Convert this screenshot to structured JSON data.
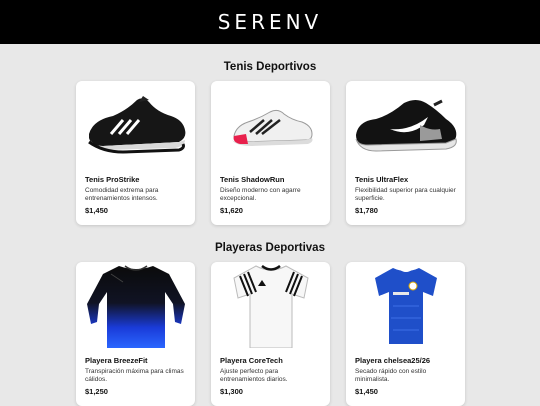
{
  "header": {
    "brand": "SERENV"
  },
  "sections": [
    {
      "title": "Tenis Deportivos",
      "products": [
        {
          "name": "Tenis ProStrike",
          "description": "Comodidad extrema para entrenamientos intensos.",
          "price": "$1,450",
          "image_icon": "black-running-shoe-icon"
        },
        {
          "name": "Tenis ShadowRun",
          "description": "Diseño moderno con agarre excepcional.",
          "price": "$1,620",
          "image_icon": "white-red-running-shoe-icon"
        },
        {
          "name": "Tenis UltraFlex",
          "description": "Flexibilidad superior para cualquier superficie.",
          "price": "$1,780",
          "image_icon": "black-white-training-shoe-icon"
        }
      ]
    },
    {
      "title": "Playeras Deportivas",
      "products": [
        {
          "name": "Playera BreezeFit",
          "description": "Transpiración máxima para climas cálidos.",
          "price": "$1,250",
          "image_icon": "black-blue-longsleeve-shirt-icon"
        },
        {
          "name": "Playera CoreTech",
          "description": "Ajuste perfecto para entrenamientos diarios.",
          "price": "$1,300",
          "image_icon": "white-jersey-icon"
        },
        {
          "name": "Playera chelsea25/26",
          "description": "Secado rápido con estilo minimalista.",
          "price": "$1,450",
          "image_icon": "blue-football-jersey-icon"
        }
      ]
    }
  ]
}
